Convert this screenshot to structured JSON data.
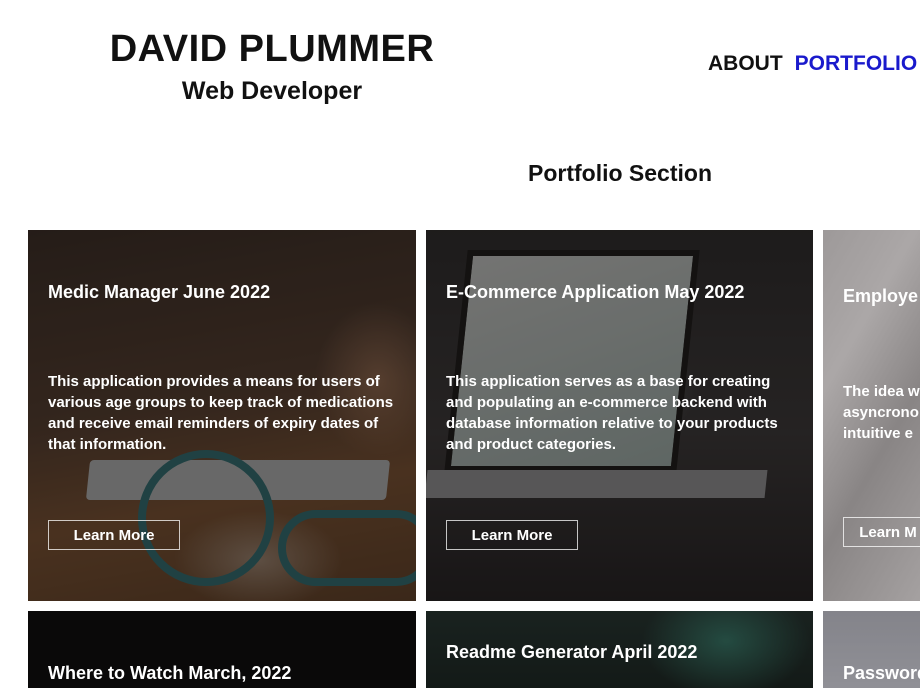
{
  "header": {
    "name": "DAVID PLUMMER",
    "role": "Web Developer"
  },
  "nav": {
    "items": [
      {
        "label": "ABOUT",
        "active": false
      },
      {
        "label": "PORTFOLIO",
        "active": true
      }
    ]
  },
  "portfolio": {
    "title": "Portfolio Section",
    "cards": [
      {
        "title": "Medic Manager June 2022",
        "description": "This application provides a means for users of various age groups to keep track of medications and receive email reminders of expiry dates of that information.",
        "button": "Learn More"
      },
      {
        "title": "E-Commerce Application May 2022",
        "description": "This application serves as a base for creating and populating an e-commerce backend with database information relative to your products and product categories.",
        "button": "Learn More"
      },
      {
        "title": "Employe",
        "description": "The idea w asyncrono intuitive e",
        "button": "Learn M"
      },
      {
        "title": "Where to Watch March, 2022"
      },
      {
        "title": "Readme Generator April 2022"
      },
      {
        "title": "Password"
      }
    ]
  },
  "colors": {
    "nav_active": "#1a1acc",
    "text": "#111111",
    "card_overlay": "rgba(20,16,14,0.55)"
  }
}
